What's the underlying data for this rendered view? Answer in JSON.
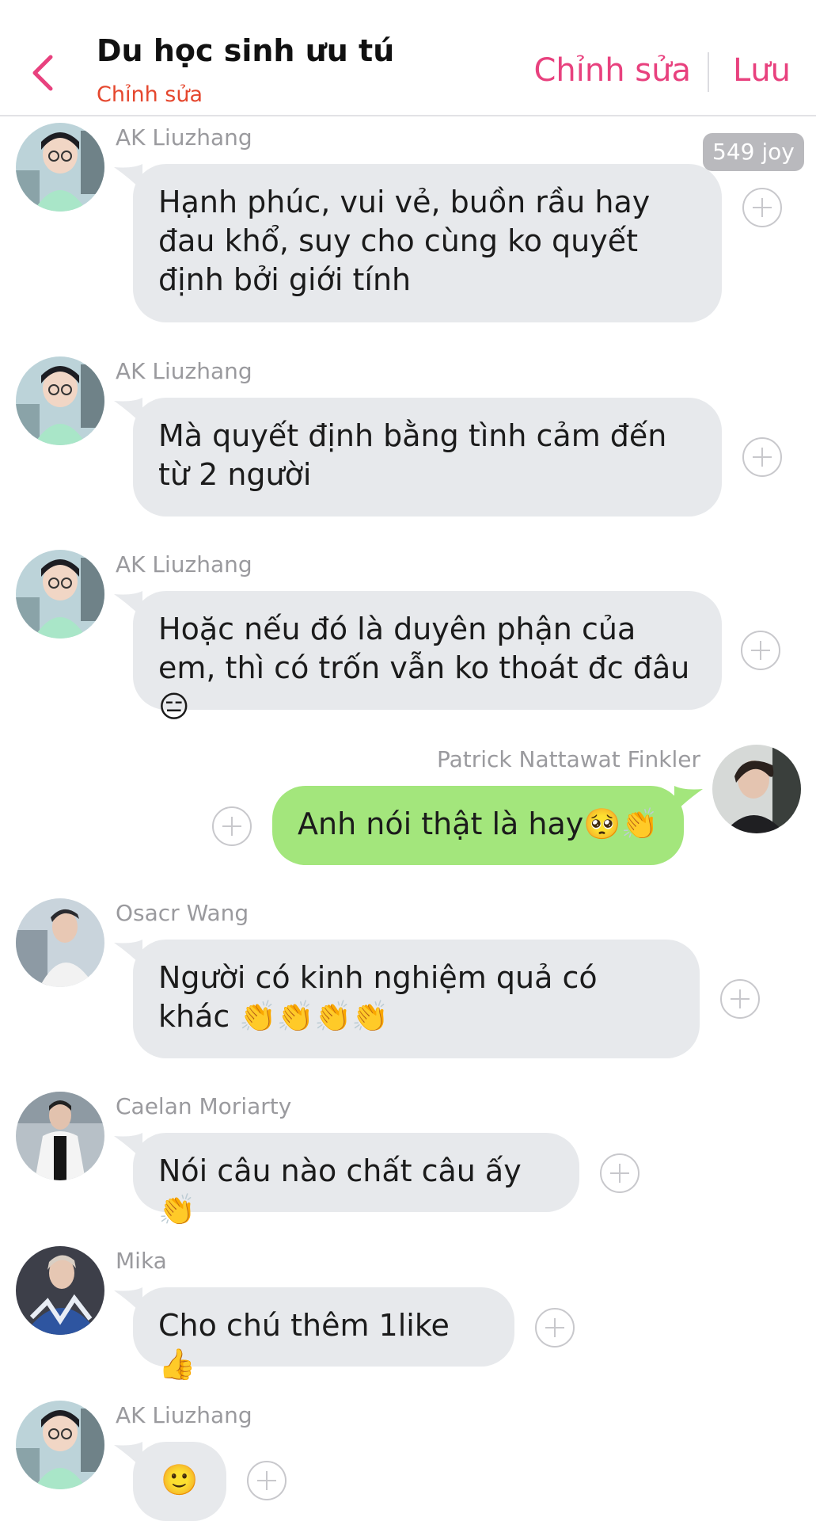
{
  "header": {
    "title": "Du học sinh ưu tú",
    "subtitle": "Chỉnh sửa",
    "edit_label": "Chỉnh sửa",
    "save_label": "Lưu",
    "accent_color": "#e8417e"
  },
  "badge": {
    "joy": "549 joy"
  },
  "messages": [
    {
      "sender": "AK Liuzhang",
      "text": "Hạnh phúc, vui vẻ, buồn rầu hay đau khổ, suy cho cùng ko quyết định bởi giới tính",
      "side": "in"
    },
    {
      "sender": "AK Liuzhang",
      "text": "Mà quyết định bằng tình cảm đến từ 2 người",
      "side": "in"
    },
    {
      "sender": "AK Liuzhang",
      "text": "Hoặc nếu đó là duyên phận của em, thì có trốn vẫn ko thoát đc đâu😑",
      "side": "in"
    },
    {
      "sender": "Patrick Nattawat Finkler",
      "text": "Anh nói thật là hay🥺👏",
      "side": "out"
    },
    {
      "sender": "Osacr Wang",
      "text": "Người có kinh nghiệm quả có khác 👏👏👏👏",
      "side": "in"
    },
    {
      "sender": "Caelan Moriarty",
      "text": "Nói câu nào chất câu ấy👏",
      "side": "in"
    },
    {
      "sender": "Mika",
      "text": "Cho chú thêm 1like 👍",
      "side": "in"
    },
    {
      "sender": "AK Liuzhang",
      "text": "🙂",
      "side": "in"
    }
  ]
}
